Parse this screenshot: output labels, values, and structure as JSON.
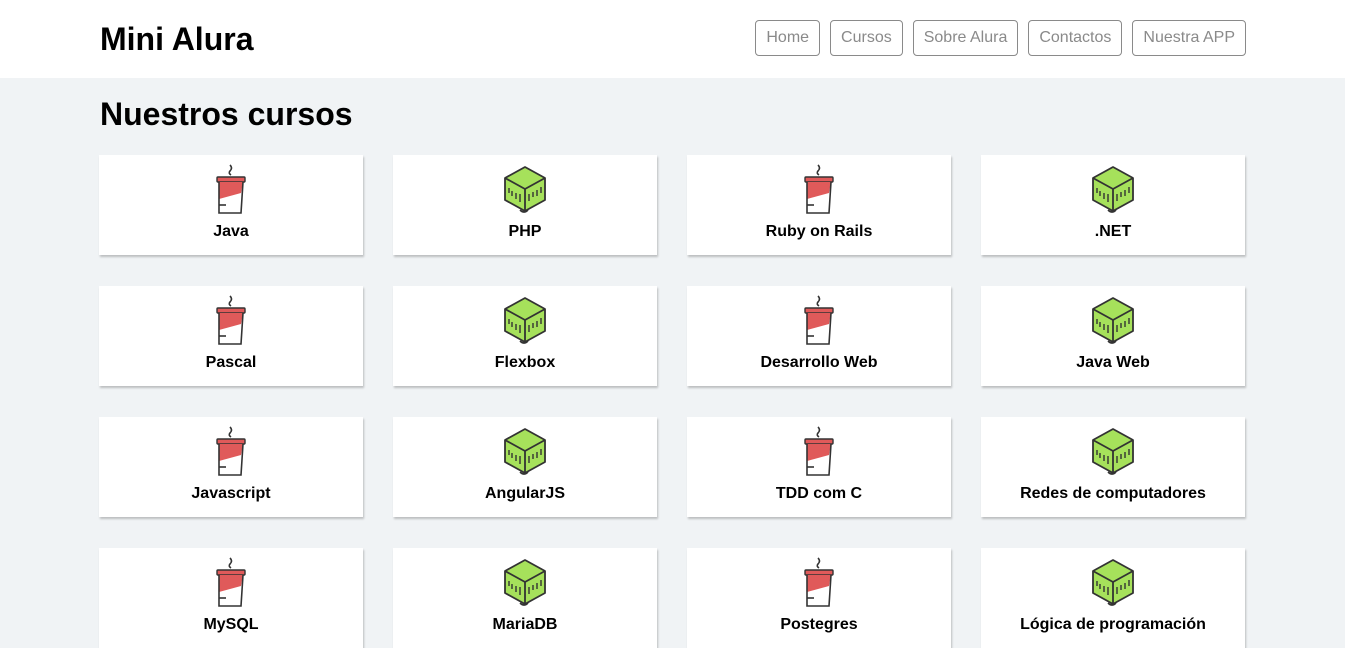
{
  "header": {
    "brand": "Mini Alura",
    "nav": [
      {
        "label": "Home"
      },
      {
        "label": "Cursos"
      },
      {
        "label": "Sobre Alura"
      },
      {
        "label": "Contactos"
      },
      {
        "label": "Nuestra APP"
      }
    ]
  },
  "main": {
    "title": "Nuestros cursos",
    "courses": [
      {
        "label": "Java",
        "icon": "coffee-cup-icon"
      },
      {
        "label": "PHP",
        "icon": "cube-icon"
      },
      {
        "label": "Ruby on Rails",
        "icon": "coffee-cup-icon"
      },
      {
        "label": ".NET",
        "icon": "cube-icon"
      },
      {
        "label": "Pascal",
        "icon": "coffee-cup-icon"
      },
      {
        "label": "Flexbox",
        "icon": "cube-icon"
      },
      {
        "label": "Desarrollo Web",
        "icon": "coffee-cup-icon"
      },
      {
        "label": "Java Web",
        "icon": "cube-icon"
      },
      {
        "label": "Javascript",
        "icon": "coffee-cup-icon"
      },
      {
        "label": "AngularJS",
        "icon": "cube-icon"
      },
      {
        "label": "TDD com C",
        "icon": "coffee-cup-icon"
      },
      {
        "label": "Redes de computadores",
        "icon": "cube-icon"
      },
      {
        "label": "MySQL",
        "icon": "coffee-cup-icon"
      },
      {
        "label": "MariaDB",
        "icon": "cube-icon"
      },
      {
        "label": "Postegres",
        "icon": "coffee-cup-icon"
      },
      {
        "label": "Lógica de programación",
        "icon": "cube-icon"
      }
    ]
  },
  "colors": {
    "page_background": "#f0f3f5",
    "card_background": "#ffffff",
    "nav_border": "#8a8a8a",
    "cup_red": "#e05a5a",
    "cube_green": "#a6e15b",
    "icon_stroke": "#333333"
  }
}
